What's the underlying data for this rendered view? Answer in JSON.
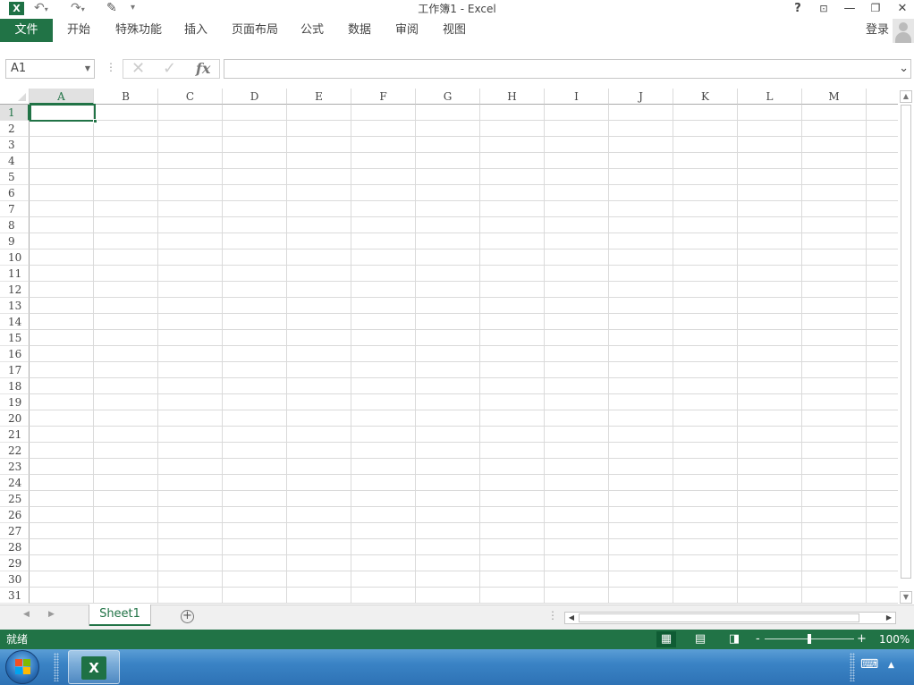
{
  "window": {
    "title": "工作簿1 - Excel",
    "app_icon": "X",
    "qat": [
      "undo-icon",
      "redo-icon",
      "brush-icon",
      "customize-icon"
    ],
    "controls": {
      "help": "?",
      "ribbon_display": "⊡",
      "minimize": "—",
      "restore": "❐",
      "close": "✕"
    }
  },
  "ribbon": {
    "file_tab": "文件",
    "tabs": [
      "开始",
      "特殊功能",
      "插入",
      "页面布局",
      "公式",
      "数据",
      "审阅",
      "视图"
    ],
    "login": "登录"
  },
  "formula_bar": {
    "name_box": "A1",
    "cancel_icon": "✕",
    "enter_icon": "✓",
    "fx": "fx",
    "formula": ""
  },
  "grid": {
    "columns": [
      "A",
      "B",
      "C",
      "D",
      "E",
      "F",
      "G",
      "H",
      "I",
      "J",
      "K",
      "L",
      "M"
    ],
    "rows": [
      "1",
      "2",
      "3",
      "4",
      "5",
      "6",
      "7",
      "8",
      "9",
      "10",
      "11",
      "12",
      "13",
      "14",
      "15",
      "16",
      "17",
      "18",
      "19",
      "20",
      "21",
      "22",
      "23",
      "24",
      "25",
      "26",
      "27",
      "28",
      "29",
      "30",
      "31"
    ],
    "active_cell": "A1"
  },
  "sheets": {
    "tabs": [
      "Sheet1"
    ],
    "active": "Sheet1",
    "add_label": "+"
  },
  "status": {
    "ready": "就绪",
    "zoom_minus": "-",
    "zoom_plus": "+",
    "zoom": "100%"
  },
  "colors": {
    "accent": "#217346",
    "status_bar": "#217346",
    "gridline": "#dadada"
  }
}
